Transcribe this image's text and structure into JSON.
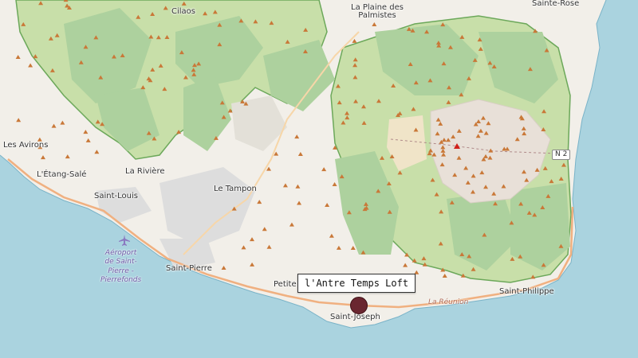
{
  "map": {
    "colors": {
      "sea": "#aad3df",
      "land": "#f2efe9",
      "forest": "#add19e",
      "park": "#c8dfa9",
      "park_border": "#6ca85a",
      "urban": "#dddddd",
      "caldera": "#e8e0d8",
      "peak": "#c97838",
      "road": "#f0b080",
      "marker": "#6a2630"
    },
    "places": [
      {
        "id": "cilaos",
        "label": "Cilaos"
      },
      {
        "id": "plaine-des-palmistes",
        "label": "La Plaine des\nPalmistes"
      },
      {
        "id": "sainte-rose",
        "label": "Sainte-Rose"
      },
      {
        "id": "les-avirons",
        "label": "Les Avirons"
      },
      {
        "id": "etang-sale",
        "label": "L'Étang-Salé"
      },
      {
        "id": "la-riviere",
        "label": "La Rivière"
      },
      {
        "id": "saint-louis",
        "label": "Saint-Louis"
      },
      {
        "id": "le-tampon",
        "label": "Le Tampon"
      },
      {
        "id": "saint-pierre",
        "label": "Saint-Pierre"
      },
      {
        "id": "petite-ile",
        "label": "Petite"
      },
      {
        "id": "saint-joseph",
        "label": "Saint-Joseph"
      },
      {
        "id": "saint-philippe",
        "label": "Saint-Philippe"
      }
    ],
    "airport_label": "Aéroport\nde Saint-\nPierre -\nPierrefonds",
    "road_label": "La Réunion",
    "road_shield": "N 2",
    "tooltip_text": "l'Antre Temps Loft",
    "icons": {
      "airport": "airplane-icon",
      "marker": "location-marker-icon",
      "peak": "peak-triangle-icon"
    }
  }
}
